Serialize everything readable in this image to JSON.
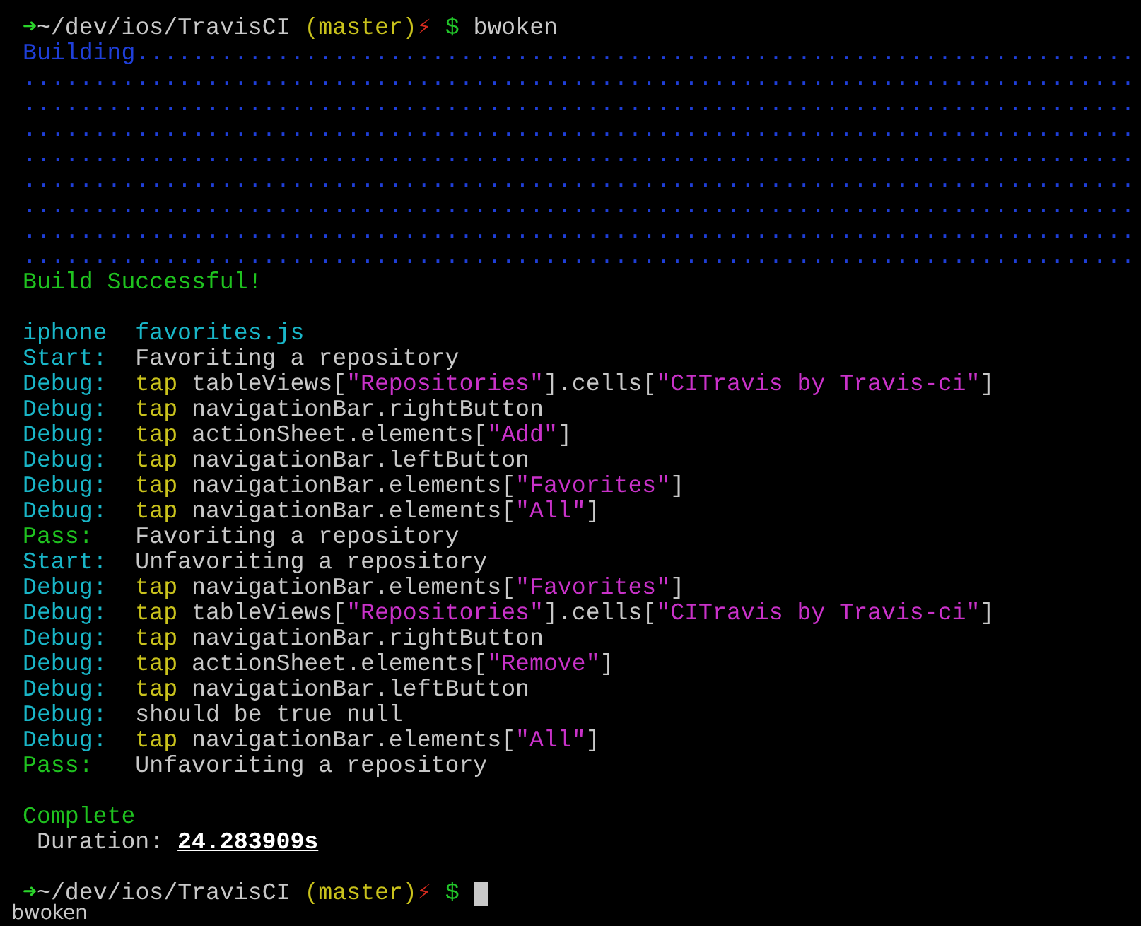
{
  "terminal": {
    "blocks": [
      {
        "lines": [
          {
            "segments": [
              {
                "text": "➜",
                "color": "#2ad42a"
              },
              {
                "text": "~/dev/ios/TravisCI ",
                "color": "#c8c8c8"
              },
              {
                "text": "(master)",
                "color": "#c9c21c"
              },
              {
                "text": "⚡",
                "color": "#d22a1e"
              },
              {
                "text": " $ ",
                "color": "#22c52a"
              },
              {
                "text": "bwoken",
                "color": "#c8c8c8"
              }
            ]
          },
          {
            "segments": [
              {
                "text": "Building",
                "color": "#1f3fd8"
              },
              {
                "text": ".......................................................................",
                "color": "#1f3fd8"
              }
            ]
          },
          {
            "segments": [
              {
                "text": "...............................................................................",
                "color": "#1f3fd8"
              }
            ]
          },
          {
            "segments": [
              {
                "text": "...............................................................................",
                "color": "#1f3fd8"
              }
            ]
          },
          {
            "segments": [
              {
                "text": "...............................................................................",
                "color": "#1f3fd8"
              }
            ]
          },
          {
            "segments": [
              {
                "text": "...............................................................................",
                "color": "#1f3fd8"
              }
            ]
          },
          {
            "segments": [
              {
                "text": "...............................................................................",
                "color": "#1f3fd8"
              }
            ]
          },
          {
            "segments": [
              {
                "text": "...............................................................................",
                "color": "#1f3fd8"
              }
            ]
          },
          {
            "segments": [
              {
                "text": "...............................................................................",
                "color": "#1f3fd8"
              }
            ]
          },
          {
            "segments": [
              {
                "text": "...............................................................................",
                "color": "#1f3fd8"
              }
            ]
          },
          {
            "segments": [
              {
                "text": "Build Successful!",
                "color": "#1fc21f"
              }
            ]
          }
        ]
      },
      {
        "lines": [
          {
            "segments": [
              {
                "text": "iphone  ",
                "color": "#19b6c8"
              },
              {
                "text": "favorites.js",
                "color": "#19b6c8"
              }
            ]
          },
          {
            "segments": [
              {
                "text": "Start:  ",
                "color": "#19b6c8"
              },
              {
                "text": "Favoriting a repository",
                "color": "#c8c8c8"
              }
            ]
          },
          {
            "segments": [
              {
                "text": "Debug:  ",
                "color": "#19b6c8"
              },
              {
                "text": "tap ",
                "color": "#c9c21c"
              },
              {
                "text": "tableViews[",
                "color": "#c8c8c8"
              },
              {
                "text": "\"Repositories\"",
                "color": "#c932c9"
              },
              {
                "text": "].cells[",
                "color": "#c8c8c8"
              },
              {
                "text": "\"CITravis by Travis-ci\"",
                "color": "#c932c9"
              },
              {
                "text": "]",
                "color": "#c8c8c8"
              }
            ]
          },
          {
            "segments": [
              {
                "text": "Debug:  ",
                "color": "#19b6c8"
              },
              {
                "text": "tap ",
                "color": "#c9c21c"
              },
              {
                "text": "navigationBar.rightButton",
                "color": "#c8c8c8"
              }
            ]
          },
          {
            "segments": [
              {
                "text": "Debug:  ",
                "color": "#19b6c8"
              },
              {
                "text": "tap ",
                "color": "#c9c21c"
              },
              {
                "text": "actionSheet.elements[",
                "color": "#c8c8c8"
              },
              {
                "text": "\"Add\"",
                "color": "#c932c9"
              },
              {
                "text": "]",
                "color": "#c8c8c8"
              }
            ]
          },
          {
            "segments": [
              {
                "text": "Debug:  ",
                "color": "#19b6c8"
              },
              {
                "text": "tap ",
                "color": "#c9c21c"
              },
              {
                "text": "navigationBar.leftButton",
                "color": "#c8c8c8"
              }
            ]
          },
          {
            "segments": [
              {
                "text": "Debug:  ",
                "color": "#19b6c8"
              },
              {
                "text": "tap ",
                "color": "#c9c21c"
              },
              {
                "text": "navigationBar.elements[",
                "color": "#c8c8c8"
              },
              {
                "text": "\"Favorites\"",
                "color": "#c932c9"
              },
              {
                "text": "]",
                "color": "#c8c8c8"
              }
            ]
          },
          {
            "segments": [
              {
                "text": "Debug:  ",
                "color": "#19b6c8"
              },
              {
                "text": "tap ",
                "color": "#c9c21c"
              },
              {
                "text": "navigationBar.elements[",
                "color": "#c8c8c8"
              },
              {
                "text": "\"All\"",
                "color": "#c932c9"
              },
              {
                "text": "]",
                "color": "#c8c8c8"
              }
            ]
          },
          {
            "segments": [
              {
                "text": "Pass:   ",
                "color": "#1fc21f"
              },
              {
                "text": "Favoriting a repository",
                "color": "#c8c8c8"
              }
            ]
          },
          {
            "segments": [
              {
                "text": "Start:  ",
                "color": "#19b6c8"
              },
              {
                "text": "Unfavoriting a repository",
                "color": "#c8c8c8"
              }
            ]
          },
          {
            "segments": [
              {
                "text": "Debug:  ",
                "color": "#19b6c8"
              },
              {
                "text": "tap ",
                "color": "#c9c21c"
              },
              {
                "text": "navigationBar.elements[",
                "color": "#c8c8c8"
              },
              {
                "text": "\"Favorites\"",
                "color": "#c932c9"
              },
              {
                "text": "]",
                "color": "#c8c8c8"
              }
            ]
          },
          {
            "segments": [
              {
                "text": "Debug:  ",
                "color": "#19b6c8"
              },
              {
                "text": "tap ",
                "color": "#c9c21c"
              },
              {
                "text": "tableViews[",
                "color": "#c8c8c8"
              },
              {
                "text": "\"Repositories\"",
                "color": "#c932c9"
              },
              {
                "text": "].cells[",
                "color": "#c8c8c8"
              },
              {
                "text": "\"CITravis by Travis-ci\"",
                "color": "#c932c9"
              },
              {
                "text": "]",
                "color": "#c8c8c8"
              }
            ]
          },
          {
            "segments": [
              {
                "text": "Debug:  ",
                "color": "#19b6c8"
              },
              {
                "text": "tap ",
                "color": "#c9c21c"
              },
              {
                "text": "navigationBar.rightButton",
                "color": "#c8c8c8"
              }
            ]
          },
          {
            "segments": [
              {
                "text": "Debug:  ",
                "color": "#19b6c8"
              },
              {
                "text": "tap ",
                "color": "#c9c21c"
              },
              {
                "text": "actionSheet.elements[",
                "color": "#c8c8c8"
              },
              {
                "text": "\"Remove\"",
                "color": "#c932c9"
              },
              {
                "text": "]",
                "color": "#c8c8c8"
              }
            ]
          },
          {
            "segments": [
              {
                "text": "Debug:  ",
                "color": "#19b6c8"
              },
              {
                "text": "tap ",
                "color": "#c9c21c"
              },
              {
                "text": "navigationBar.leftButton",
                "color": "#c8c8c8"
              }
            ]
          },
          {
            "segments": [
              {
                "text": "Debug:  ",
                "color": "#19b6c8"
              },
              {
                "text": "should be true null",
                "color": "#c8c8c8"
              }
            ]
          },
          {
            "segments": [
              {
                "text": "Debug:  ",
                "color": "#19b6c8"
              },
              {
                "text": "tap ",
                "color": "#c9c21c"
              },
              {
                "text": "navigationBar.elements[",
                "color": "#c8c8c8"
              },
              {
                "text": "\"All\"",
                "color": "#c932c9"
              },
              {
                "text": "]",
                "color": "#c8c8c8"
              }
            ]
          },
          {
            "segments": [
              {
                "text": "Pass:   ",
                "color": "#1fc21f"
              },
              {
                "text": "Unfavoriting a repository",
                "color": "#c8c8c8"
              }
            ]
          }
        ]
      },
      {
        "lines": [
          {
            "segments": [
              {
                "text": "Complete",
                "color": "#1fc21f"
              }
            ]
          },
          {
            "segments": [
              {
                "text": " Duration: ",
                "color": "#c8c8c8"
              },
              {
                "text": "24.283909s",
                "color": "#ffffff",
                "emphasis": true
              }
            ]
          }
        ]
      },
      {
        "lines": [
          {
            "cursor": true,
            "segments": [
              {
                "text": "➜",
                "color": "#2ad42a"
              },
              {
                "text": "~/dev/ios/TravisCI ",
                "color": "#c8c8c8"
              },
              {
                "text": "(master)",
                "color": "#c9c21c"
              },
              {
                "text": "⚡",
                "color": "#d22a1e"
              },
              {
                "text": " $ ",
                "color": "#22c52a"
              }
            ]
          }
        ]
      }
    ]
  },
  "window_label": "bwoken"
}
